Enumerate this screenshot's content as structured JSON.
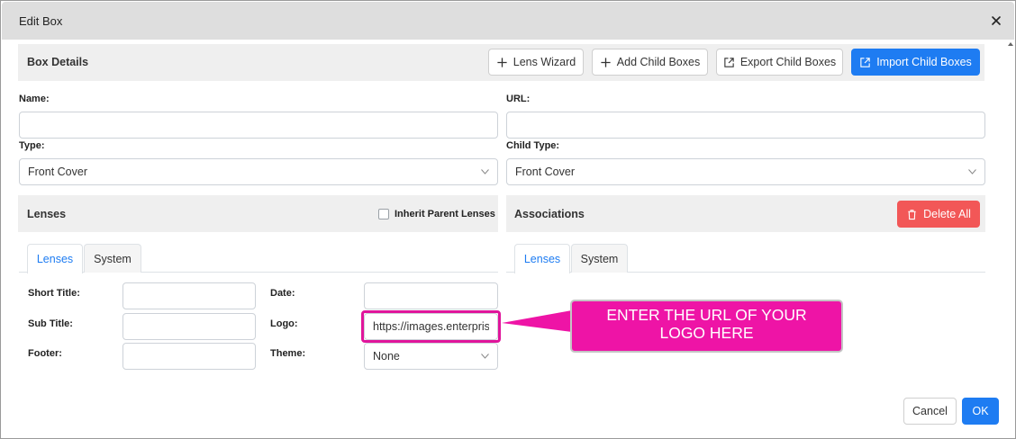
{
  "dialog": {
    "title": "Edit Box"
  },
  "box_details": {
    "title": "Box Details",
    "buttons": {
      "lens_wizard": "Lens Wizard",
      "add_child_boxes": "Add Child Boxes",
      "export_child_boxes": "Export Child Boxes",
      "import_child_boxes": "Import Child Boxes"
    },
    "fields": {
      "name_label": "Name:",
      "name_value": "",
      "url_label": "URL:",
      "url_value": "",
      "type_label": "Type:",
      "type_value": "Front Cover",
      "child_type_label": "Child Type:",
      "child_type_value": "Front Cover"
    }
  },
  "lenses": {
    "title": "Lenses",
    "inherit_label": "Inherit Parent Lenses",
    "inherit_checked": false,
    "tabs": [
      "Lenses",
      "System"
    ],
    "active_tab": "Lenses",
    "fields": {
      "short_title_label": "Short Title:",
      "short_title_value": "",
      "sub_title_label": "Sub Title:",
      "sub_title_value": "",
      "footer_label": "Footer:",
      "footer_value": "",
      "date_label": "Date:",
      "date_value": "",
      "logo_label": "Logo:",
      "logo_value": "https://images.enterprise",
      "theme_label": "Theme:",
      "theme_value": "None"
    }
  },
  "associations": {
    "title": "Associations",
    "delete_all": "Delete All",
    "tabs": [
      "Lenses",
      "System"
    ],
    "active_tab": "Lenses"
  },
  "callout": {
    "line1": "ENTER THE URL OF YOUR",
    "line2": "LOGO HERE",
    "color": "#ee14a6"
  },
  "footer": {
    "cancel": "Cancel",
    "ok": "OK"
  },
  "colors": {
    "primary": "#1e7cf2",
    "danger": "#f25757",
    "highlight": "#e0159b"
  }
}
